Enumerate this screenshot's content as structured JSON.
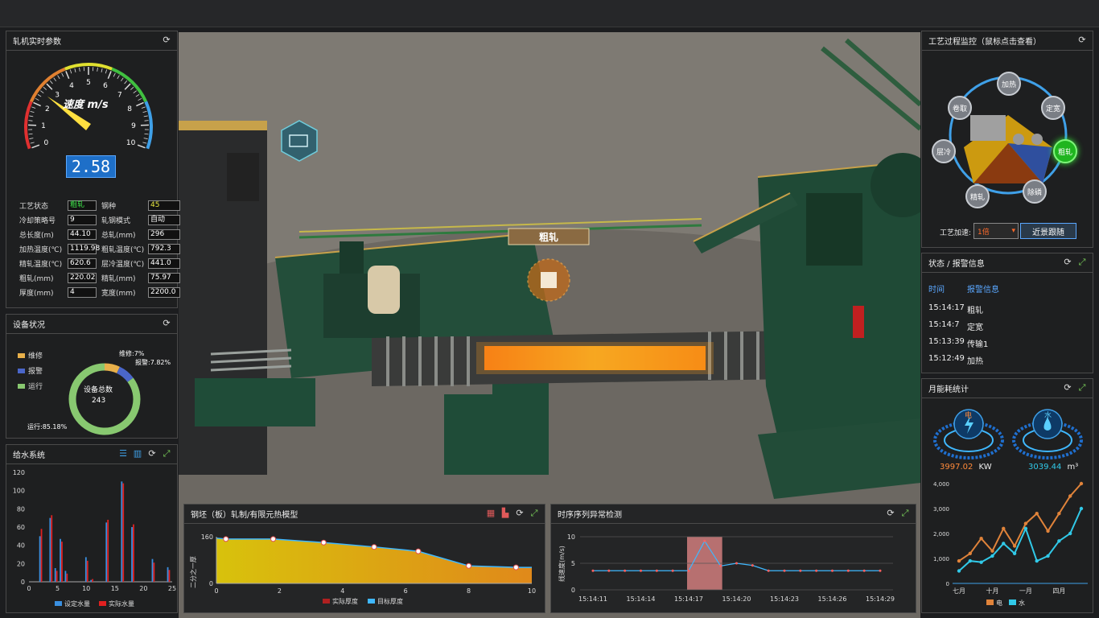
{
  "colors": {
    "accent_blue": "#3a8fe0",
    "accent_red": "#e02020",
    "accent_green": "#3ee64a",
    "accent_orange": "#e0833a",
    "water_cyan": "#31c9e8"
  },
  "scene": {
    "stage_label": "粗轧"
  },
  "roll_params": {
    "title": "轧机实时参数",
    "gauge": {
      "label": "速度 m/s",
      "value": "2.58",
      "ticks": [
        "0",
        "1",
        "2",
        "3",
        "4",
        "5",
        "6",
        "7",
        "8",
        "9",
        "10"
      ],
      "speed": 2.58,
      "max": 10
    },
    "rows": [
      {
        "l1": "工艺状态",
        "v1": "粗轧",
        "l2": "钢种",
        "v2": "45"
      },
      {
        "l1": "冷却策略号",
        "v1": "9",
        "l2": "轧钢模式",
        "v2": "自动"
      },
      {
        "l1": "总长度(m)",
        "v1": "44.10",
        "l2": "总轧(mm)",
        "v2": "296"
      },
      {
        "l1": "加热温度(℃)",
        "v1": "1119.98",
        "l2": "粗轧温度(℃)",
        "v2": "792.3"
      },
      {
        "l1": "精轧温度(℃)",
        "v1": "620.6",
        "l2": "层冷温度(℃)",
        "v2": "441.0"
      },
      {
        "l1": "粗轧(mm)",
        "v1": "220.02",
        "l2": "精轧(mm)",
        "v2": "75.97"
      },
      {
        "l1": "厚度(mm)",
        "v1": "4",
        "l2": "宽度(mm)",
        "v2": "2200.0"
      }
    ]
  },
  "equipment": {
    "title": "设备状况",
    "legend": [
      "维修",
      "报警",
      "运行"
    ],
    "legend_colors": [
      "#e8b04a",
      "#4a66c9",
      "#88c870"
    ],
    "center_label": "设备总数",
    "center_value": "243",
    "labels": {
      "maint": "维修:7%",
      "alarm": "报警:7.82%",
      "run": "运行:85.18%"
    },
    "fractions": [
      0.07,
      0.0782,
      0.8518
    ]
  },
  "water": {
    "title": "给水系统",
    "chart_data": {
      "type": "bar",
      "y_ticks": [
        "0",
        "20",
        "40",
        "60",
        "80",
        "100",
        "120"
      ],
      "x_ticks": [
        "0",
        "5",
        "10",
        "15",
        "20",
        "25"
      ],
      "ylim": [
        0,
        120
      ],
      "xlim": [
        0,
        25
      ],
      "legend": [
        "设定水量",
        "实际水量"
      ],
      "series": [
        {
          "name": "设定水量",
          "color": "#3a8fe0",
          "points": [
            [
              2,
              50
            ],
            [
              4,
              70
            ],
            [
              5,
              15
            ],
            [
              6,
              47
            ],
            [
              7,
              12
            ],
            [
              11,
              27
            ],
            [
              12,
              2
            ],
            [
              15,
              65
            ],
            [
              18,
              110
            ],
            [
              20,
              60
            ],
            [
              24,
              25
            ],
            [
              27,
              16
            ]
          ]
        },
        {
          "name": "实际水量",
          "color": "#e02020",
          "points": [
            [
              2.3,
              58
            ],
            [
              4.3,
              73
            ],
            [
              5.3,
              12
            ],
            [
              6.3,
              44
            ],
            [
              7.3,
              9
            ],
            [
              11.3,
              23
            ],
            [
              12.3,
              3
            ],
            [
              15.3,
              68
            ],
            [
              18.3,
              108
            ],
            [
              20.3,
              63
            ],
            [
              24.3,
              21
            ],
            [
              27.3,
              13
            ]
          ]
        }
      ]
    }
  },
  "thermal": {
    "title": "钢坯（板）轧制/有限元热模型",
    "chart_data": {
      "type": "area",
      "ylabel": "二分之一厚",
      "y_ticks": [
        "0",
        "160"
      ],
      "x_ticks": [
        "0",
        "2",
        "4",
        "6",
        "8",
        "10"
      ],
      "xlim": [
        0,
        10
      ],
      "ylim": [
        0,
        160
      ],
      "legend": [
        "实际厚度",
        "目标厚度"
      ],
      "x": [
        0,
        0.3,
        1.8,
        3.4,
        5,
        6.4,
        8,
        9.5,
        10
      ],
      "y": [
        155,
        152,
        152,
        140,
        125,
        110,
        60,
        55,
        55
      ],
      "marker_x": [
        0.3,
        1.8,
        3.4,
        5,
        6.4,
        8,
        9.5
      ]
    }
  },
  "timeseries": {
    "title": "时序序列异常检测",
    "chart_data": {
      "type": "line",
      "ylabel": "线速度(m/s)",
      "y_ticks": [
        "0",
        "5",
        "10"
      ],
      "ylim": [
        0,
        10
      ],
      "x_ticks": [
        "15:14:11",
        "15:14:14",
        "15:14:17",
        "15:14:20",
        "15:14:23",
        "15:14:26",
        "15:14:29"
      ],
      "values": [
        3.6,
        3.6,
        3.6,
        3.6,
        3.6,
        3.6,
        3.6,
        9.2,
        4.5,
        5,
        4.6,
        3.6,
        3.6,
        3.6,
        3.6,
        3.6,
        3.6,
        3.6,
        3.6
      ],
      "anomaly_range": [
        6,
        8
      ]
    }
  },
  "process": {
    "title": "工艺过程监控（鼠标点击查看）",
    "nodes": [
      {
        "label": "加热",
        "active": false
      },
      {
        "label": "定宽",
        "active": false
      },
      {
        "label": "粗轧",
        "active": true
      },
      {
        "label": "除磷",
        "active": false
      },
      {
        "label": "精轧",
        "active": false
      },
      {
        "label": "层冷",
        "active": false
      },
      {
        "label": "卷取",
        "active": false
      }
    ],
    "speedup_label": "工艺加速:",
    "speedup_value": "1倍",
    "follow_button": "近景跟随"
  },
  "status": {
    "title": "状态 / 报警信息",
    "headers": [
      "时间",
      "报警信息"
    ],
    "rows": [
      {
        "time": "15:14:17",
        "msg": "粗轧"
      },
      {
        "time": "15:14:7",
        "msg": "定宽"
      },
      {
        "time": "15:13:39",
        "msg": "传输1"
      },
      {
        "time": "15:12:49",
        "msg": "加热"
      }
    ]
  },
  "energy": {
    "title": "月能耗统计",
    "elec_label": "电",
    "elec_value": "3997.02",
    "elec_unit": "KW",
    "water_label": "水",
    "water_value": "3039.44",
    "water_unit": "m³",
    "chart_data": {
      "type": "line",
      "y_ticks": [
        "0",
        "1,000",
        "2,000",
        "3,000",
        "4,000"
      ],
      "ylim": [
        0,
        4000
      ],
      "x_ticks": [
        "七月",
        "十月",
        "一月",
        "四月"
      ],
      "legend": [
        "电",
        "水"
      ],
      "series": [
        {
          "name": "电",
          "color": "#e0833a",
          "values": [
            900,
            1200,
            1800,
            1300,
            2200,
            1500,
            2400,
            2800,
            2100,
            2800,
            3500,
            4000
          ]
        },
        {
          "name": "水",
          "color": "#31c9e8",
          "values": [
            500,
            900,
            850,
            1100,
            1600,
            1200,
            2200,
            900,
            1100,
            1700,
            2000,
            3000
          ]
        }
      ]
    }
  }
}
